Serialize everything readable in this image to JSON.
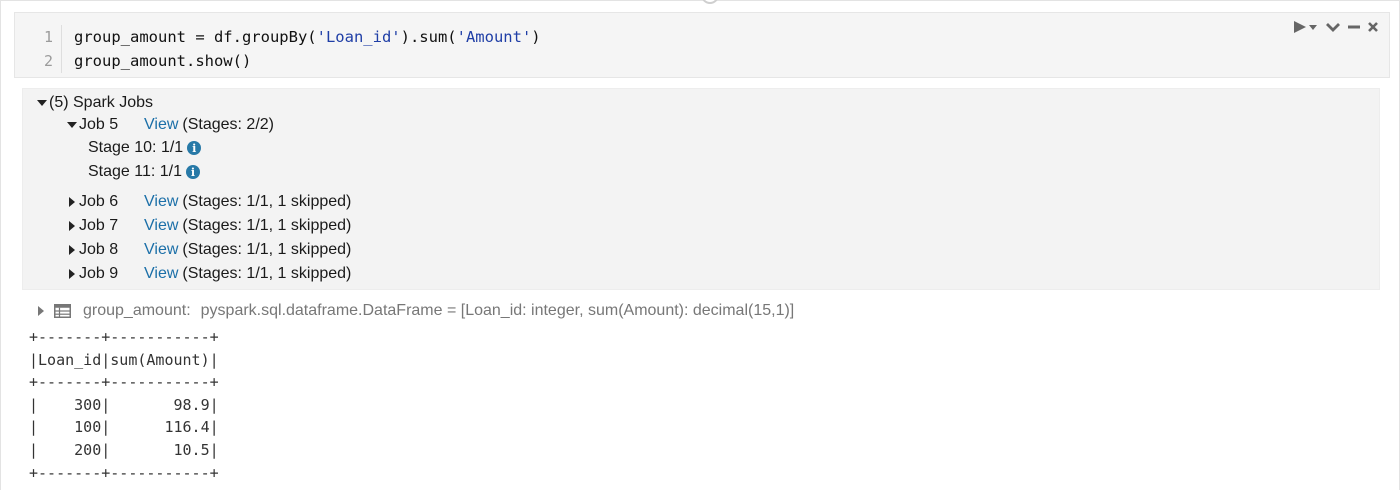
{
  "code_cell": {
    "lines": [
      {
        "num": "1",
        "segments": [
          {
            "text": "group_amount = df.groupBy(",
            "kind": "plain"
          },
          {
            "text": "'Loan_id'",
            "kind": "string"
          },
          {
            "text": ").sum(",
            "kind": "plain"
          },
          {
            "text": "'Amount'",
            "kind": "string"
          },
          {
            "text": ")",
            "kind": "plain"
          }
        ]
      },
      {
        "num": "2",
        "segments": [
          {
            "text": "group_amount.show()",
            "kind": "plain"
          }
        ]
      }
    ],
    "toolbar": {
      "run_icon": "play-dropdown-icon",
      "collapse_icon": "chevron-down-icon",
      "minimize_icon": "minus-icon",
      "close_icon": "close-icon"
    }
  },
  "spark_jobs": {
    "header": "(5) Spark Jobs",
    "jobs": [
      {
        "label": "Job 5",
        "link": "View",
        "stages_text": "(Stages: 2/2)",
        "expanded": true,
        "stages": [
          {
            "label": "Stage 10: 1/1",
            "info_glyph": "i"
          },
          {
            "label": "Stage 11: 1/1",
            "info_glyph": "i"
          }
        ]
      },
      {
        "label": "Job 6",
        "link": "View",
        "stages_text": "(Stages: 1/1, 1 skipped)",
        "expanded": false
      },
      {
        "label": "Job 7",
        "link": "View",
        "stages_text": "(Stages: 1/1, 1 skipped)",
        "expanded": false
      },
      {
        "label": "Job 8",
        "link": "View",
        "stages_text": "(Stages: 1/1, 1 skipped)",
        "expanded": false
      },
      {
        "label": "Job 9",
        "link": "View",
        "stages_text": "(Stages: 1/1, 1 skipped)",
        "expanded": false
      }
    ]
  },
  "dataframe": {
    "name": "group_amount:",
    "schema": "pyspark.sql.dataframe.DataFrame = [Loan_id: integer, sum(Amount): decimal(15,1)]"
  },
  "output_lines": [
    "+-------+-----------+",
    "|Loan_id|sum(Amount)|",
    "+-------+-----------+",
    "|    300|       98.9|",
    "|    100|      116.4|",
    "|    200|       10.5|",
    "+-------+-----------+"
  ],
  "colors": {
    "string_token": "#1f3ea6",
    "link": "#1b6fa8",
    "info_badge": "#2779a7"
  }
}
